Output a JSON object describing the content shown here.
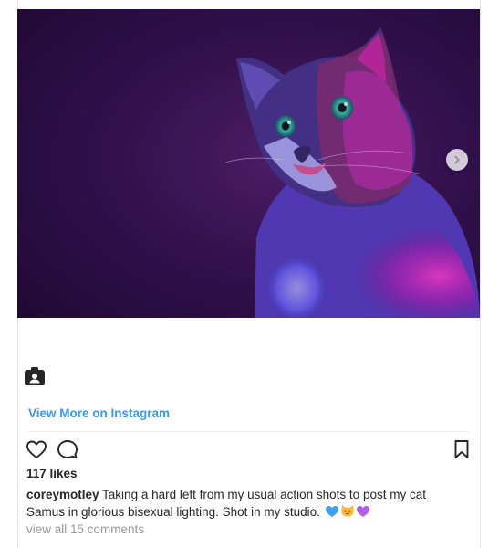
{
  "post": {
    "view_more_label": "View More on Instagram",
    "likes_text": "117 likes",
    "username": "coreymotley",
    "caption_text": " Taking a hard left from my usual action shots to post my cat Samus in glorious bisexual lighting. Shot in my studio. ",
    "emojis": [
      "blue-heart",
      "cat-face",
      "purple-heart"
    ],
    "comments_link": "view all 15 comments"
  },
  "icons": {
    "instagram_glyph": "instagram-glyph-icon",
    "carousel_next": "chevron-right-icon",
    "like": "heart-icon",
    "comment": "comment-bubble-icon",
    "save": "bookmark-icon"
  },
  "colors": {
    "link_blue": "#3897f0",
    "text": "#262626",
    "muted": "#999999",
    "image_background": "#2a0b3f",
    "magenta_light": "#e82fd0",
    "blue_light": "#5b57ff"
  }
}
